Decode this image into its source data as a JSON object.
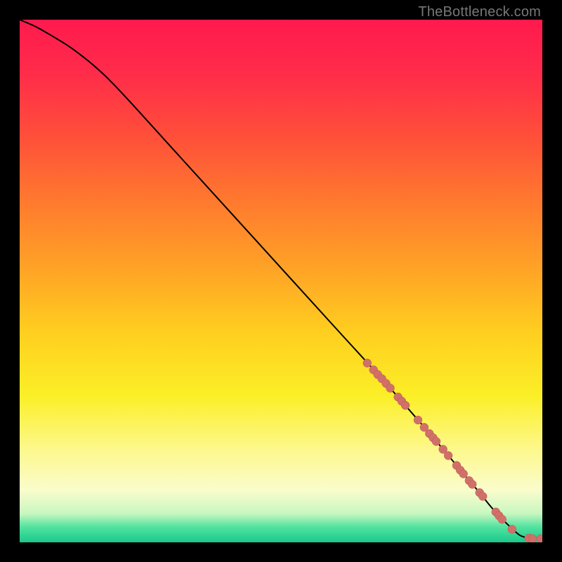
{
  "watermark": "TheBottleneck.com",
  "colors": {
    "gradient_stops": [
      {
        "offset": 0.0,
        "color": "#ff1a4d"
      },
      {
        "offset": 0.1,
        "color": "#ff2b4a"
      },
      {
        "offset": 0.22,
        "color": "#ff4e3a"
      },
      {
        "offset": 0.35,
        "color": "#ff7a2e"
      },
      {
        "offset": 0.48,
        "color": "#ffa426"
      },
      {
        "offset": 0.6,
        "color": "#ffcf1f"
      },
      {
        "offset": 0.72,
        "color": "#fbef27"
      },
      {
        "offset": 0.82,
        "color": "#fdf88a"
      },
      {
        "offset": 0.9,
        "color": "#fafccc"
      },
      {
        "offset": 0.945,
        "color": "#c8f7c0"
      },
      {
        "offset": 0.97,
        "color": "#54e3a0"
      },
      {
        "offset": 1.0,
        "color": "#18c98c"
      }
    ],
    "curve": "#000000",
    "marker_fill": "#d17069",
    "marker_stroke": "#b85a53"
  },
  "chart_data": {
    "type": "line",
    "title": "",
    "xlabel": "",
    "ylabel": "",
    "xlim": [
      0,
      100
    ],
    "ylim": [
      0,
      100
    ],
    "grid": false,
    "legend": null,
    "series": [
      {
        "name": "curve",
        "x": [
          0,
          3,
          6,
          10,
          15,
          20,
          30,
          40,
          50,
          60,
          70,
          80,
          85,
          88,
          90,
          92,
          94,
          95,
          96,
          98,
          100
        ],
        "y": [
          100,
          98.7,
          97.0,
          94.5,
          90.5,
          85.5,
          74.5,
          63.5,
          52.5,
          41.5,
          30.5,
          19.0,
          13.0,
          9.5,
          7.0,
          4.8,
          2.8,
          1.9,
          1.2,
          0.7,
          0.7
        ]
      }
    ],
    "markers": [
      {
        "x": 66.5,
        "y": 34.3
      },
      {
        "x": 67.7,
        "y": 33.0
      },
      {
        "x": 68.5,
        "y": 32.1
      },
      {
        "x": 69.3,
        "y": 31.3
      },
      {
        "x": 70.1,
        "y": 30.4
      },
      {
        "x": 70.9,
        "y": 29.5
      },
      {
        "x": 72.4,
        "y": 27.8
      },
      {
        "x": 73.1,
        "y": 27.0
      },
      {
        "x": 73.8,
        "y": 26.2
      },
      {
        "x": 76.2,
        "y": 23.4
      },
      {
        "x": 77.4,
        "y": 22.0
      },
      {
        "x": 78.4,
        "y": 20.8
      },
      {
        "x": 79.1,
        "y": 20.0
      },
      {
        "x": 79.7,
        "y": 19.3
      },
      {
        "x": 81.0,
        "y": 17.8
      },
      {
        "x": 82.0,
        "y": 16.6
      },
      {
        "x": 83.6,
        "y": 14.7
      },
      {
        "x": 84.3,
        "y": 13.8
      },
      {
        "x": 84.9,
        "y": 13.1
      },
      {
        "x": 86.0,
        "y": 11.8
      },
      {
        "x": 86.6,
        "y": 11.1
      },
      {
        "x": 88.0,
        "y": 9.5
      },
      {
        "x": 88.6,
        "y": 8.8
      },
      {
        "x": 91.1,
        "y": 5.8
      },
      {
        "x": 91.7,
        "y": 5.1
      },
      {
        "x": 92.3,
        "y": 4.4
      },
      {
        "x": 94.2,
        "y": 2.5
      },
      {
        "x": 97.4,
        "y": 0.8
      },
      {
        "x": 98.1,
        "y": 0.7
      },
      {
        "x": 99.7,
        "y": 0.7
      }
    ],
    "marker_radius_pct": 0.8
  }
}
